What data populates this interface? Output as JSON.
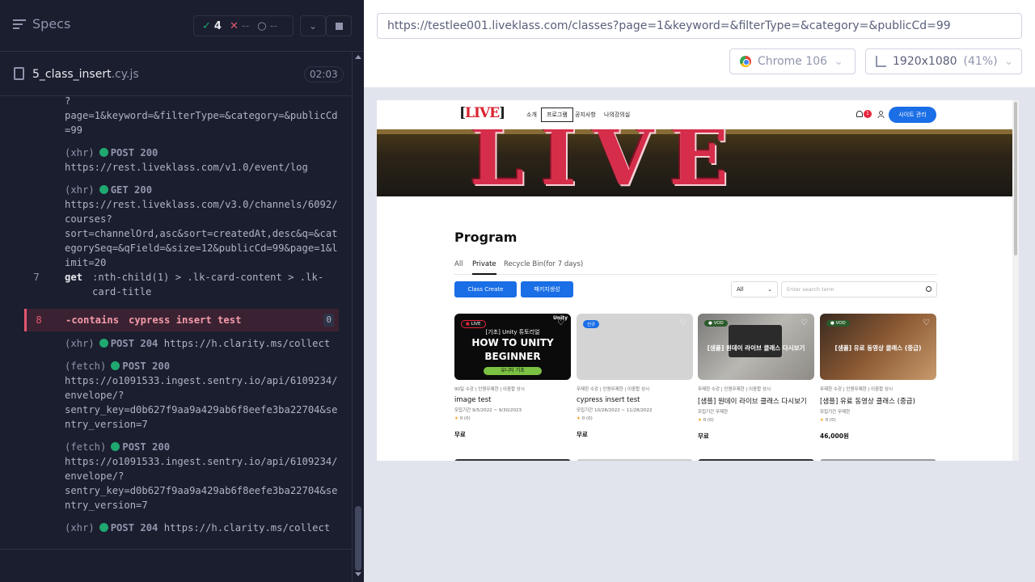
{
  "reporter": {
    "title": "Specs",
    "passed_count": "4",
    "failed_count": "--",
    "pending_count": "--",
    "spec_file": "5_class_insert",
    "spec_ext": ".cy.js",
    "duration": "02:03",
    "logs": [
      {
        "text": "?\npage=1&keyword=&filterType=&category=&publicCd\n=99"
      },
      {
        "kind": "(xhr)",
        "method": "POST 200",
        "url": "https://rest.liveklass.com/v1.0/event/log"
      },
      {
        "kind": "(xhr)",
        "method": "GET 200",
        "url": "https://rest.liveklass.com/v3.0/channels/6092/\ncourses?\nsort=channelOrd,asc&sort=createdAt,desc&q=&cat\negorySeq=&qField=&size=12&publicCd=99&page=1&l\nimit=20"
      },
      {
        "line": "7",
        "name": "get",
        "message": ":nth-child(1) > .lk-card-content > .lk-\ncard-title"
      },
      {
        "line": "8",
        "name": "-contains",
        "message": "cypress insert test",
        "badge": "0"
      },
      {
        "kind": "(xhr)",
        "method": "POST 204",
        "url": "https://h.clarity.ms/collect"
      },
      {
        "kind": "(fetch)",
        "method": "POST 200",
        "url": "https://o1091533.ingest.sentry.io/api/6109234/\nenvelope/?\nsentry_key=d0b627f9aa9a429ab6f8eefe3ba22704&se\nntry_version=7"
      },
      {
        "kind": "(fetch)",
        "method": "POST 200",
        "url": "https://o1091533.ingest.sentry.io/api/6109234/\nenvelope/?\nsentry_key=d0b627f9aa9a429ab6f8eefe3ba22704&se\nntry_version=7"
      },
      {
        "kind": "(xhr)",
        "method": "POST 204",
        "url": "https://h.clarity.ms/collect"
      }
    ]
  },
  "aut": {
    "url": "https://testlee001.liveklass.com/classes?page=1&keyword=&filterType=&category=&publicCd=99",
    "browser": "Chrome 106",
    "viewport": "1920x1080",
    "scale": "(41%)"
  },
  "site": {
    "logo": "LIVE",
    "nav": [
      "소개",
      "프로그램",
      "공지사항",
      "나의강의실"
    ],
    "notif_count": "1",
    "admin_label": "사이트 관리",
    "hero_text": "LIVE",
    "program_title": "Program",
    "tabs": [
      "All",
      "Private",
      "Recycle Bin(for 7 days)"
    ],
    "create_btn": "Class Create",
    "package_btn": "패키지생성",
    "filter_value": "All",
    "search_placeholder": "Enter search term",
    "cards": [
      {
        "tag": "LIVE",
        "tag_color": "#e8243b",
        "caption_top": "[기초] Unity 튜토리얼",
        "caption_main": "HOW TO UNITY\nBEGINNER",
        "caption_sub": "유니티 기초",
        "brand": "Unity",
        "meta": "90일 수강 | 인원무제한 | 이중합 상시",
        "title": "image test",
        "period": "모집기간 9/5/2022 ~ 9/30/2023",
        "rating": "0 (0)",
        "price": "무료"
      },
      {
        "tag": "신규",
        "tag_color": "#1a6ee6",
        "meta": "무제한 수강 | 인원무제한 | 이중합 상시",
        "title": "cypress insert test",
        "period": "모집기간 10/28/2022 ~ 11/28/2022",
        "rating": "0 (0)",
        "price": "무료"
      },
      {
        "tag": "VOD",
        "tag_color": "#3a8e3a",
        "caption_main": "[샘플] 원데이 라이브 클래스 다시보기",
        "meta": "무제한 수강 | 인원무제한 | 이중합 상시",
        "title": "[샘플] 원데이 라이브 클래스 다시보기",
        "period": "모집기간 무제한",
        "rating": "0 (0)",
        "price": "무료"
      },
      {
        "tag": "VOD",
        "tag_color": "#3a8e3a",
        "caption_main": "[샘플] 유료 동영상 클래스 (중급)",
        "meta": "무제한 수강 | 인원무제한 | 이중합 상시",
        "title": "[샘플] 유료 동영상 클래스 (중급)",
        "period": "모집기간 무제한",
        "rating": "0 (0)",
        "price": "46,000원"
      }
    ]
  }
}
